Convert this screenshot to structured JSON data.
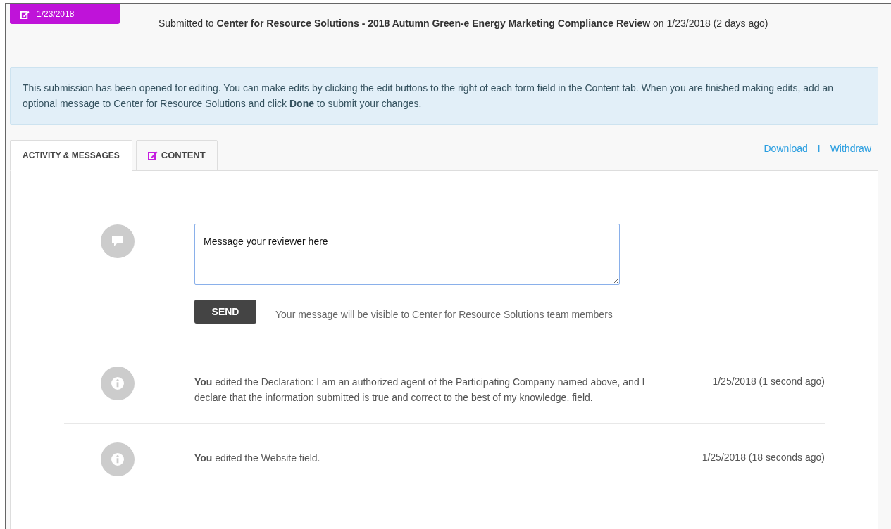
{
  "badge": {
    "date": "1/23/2018"
  },
  "submitted": "Submitted to **Center for Resource Solutions - 2018 Autumn Green-e Energy Marketing Compliance Review** on 1/23/2018 (2 days ago)",
  "notice": "This submission has been opened for editing. You can make edits by clicking the edit buttons to the right of each form field in the Content tab. When you are finished making edits, add an optional message to Center for Resource Solutions and click **Done** to submit your changes.",
  "tabs": [
    {
      "label": "ACTIVITY & MESSAGES",
      "selected": true,
      "kind": "plain"
    },
    {
      "label": "CONTENT",
      "selected": false,
      "kind": "edit"
    }
  ],
  "links": [
    "Download",
    "Withdraw"
  ],
  "link_separator": "I",
  "composer": {
    "value": "Message your reviewer here",
    "button": "SEND",
    "note": "Your message will be visible to Center for Resource Solutions team members"
  },
  "activity": [
    {
      "text": "**You** edited the Declaration: I am an authorized agent of the Participating Company named above, and I declare that the information submitted is true and correct to the best of my knowledge. field.",
      "time": "1/25/2018 (1 second ago)"
    },
    {
      "text": "**You** edited the Website field.",
      "time": "1/25/2018 (18 seconds ago)"
    }
  ]
}
